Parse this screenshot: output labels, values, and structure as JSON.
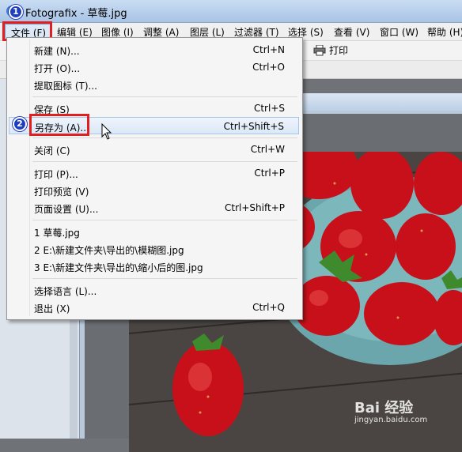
{
  "window": {
    "title": "Fotografix - 草莓.jpg"
  },
  "menubar": {
    "items": [
      "文件 (F)",
      "编辑 (E)",
      "图像 (I)",
      "调整 (A)",
      "图层 (L)",
      "过滤器 (T)",
      "选择 (S)",
      "查看 (V)",
      "窗口 (W)",
      "帮助 (H)"
    ]
  },
  "toolbar": {
    "print_label": "打印"
  },
  "file_menu": {
    "items": [
      {
        "label": "新建 (N)...",
        "shortcut": "Ctrl+N"
      },
      {
        "label": "打开 (O)...",
        "shortcut": "Ctrl+O"
      },
      {
        "label": "提取图标 (T)...",
        "shortcut": ""
      },
      {
        "label": "保存 (S)",
        "shortcut": "Ctrl+S"
      },
      {
        "label": "另存为 (A)...",
        "shortcut": "Ctrl+Shift+S"
      },
      {
        "label": "关闭 (C)",
        "shortcut": "Ctrl+W"
      },
      {
        "label": "打印 (P)...",
        "shortcut": "Ctrl+P"
      },
      {
        "label": "打印预览 (V)",
        "shortcut": ""
      },
      {
        "label": "页面设置 (U)...",
        "shortcut": "Ctrl+Shift+P"
      },
      {
        "label": "1 草莓.jpg",
        "shortcut": ""
      },
      {
        "label": "2 E:\\新建文件夹\\导出的\\模糊图.jpg",
        "shortcut": ""
      },
      {
        "label": "3 E:\\新建文件夹\\导出的\\缩小后的图.jpg",
        "shortcut": ""
      },
      {
        "label": "选择语言 (L)...",
        "shortcut": ""
      },
      {
        "label": "退出 (X)",
        "shortcut": "Ctrl+Q"
      }
    ]
  },
  "steps": {
    "one": "1",
    "two": "2"
  },
  "watermark": {
    "text": "Bai 经验",
    "sub": "jingyan.baidu.com"
  },
  "colors": {
    "highlight_border": "#e02020",
    "badge": "#1f3fbf",
    "menu_hover": "#dbe8f7"
  }
}
